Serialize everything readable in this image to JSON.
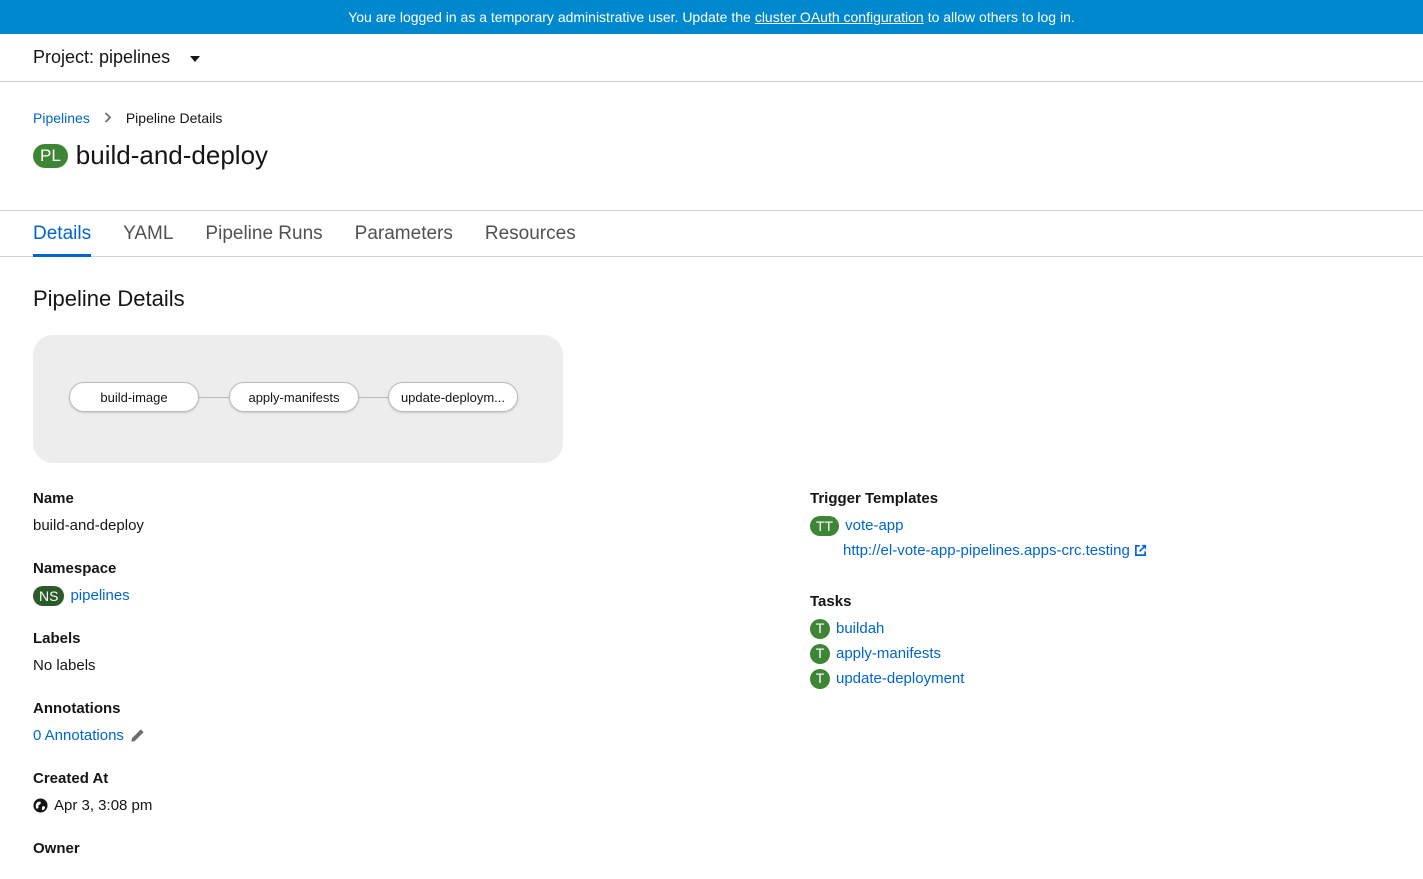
{
  "banner": {
    "text_before": "You are logged in as a temporary administrative user. Update the",
    "link": "cluster OAuth configuration",
    "text_after": "to allow others to log in."
  },
  "project": {
    "label": "Project: pipelines"
  },
  "breadcrumb": {
    "parent": "Pipelines",
    "current": "Pipeline Details"
  },
  "header": {
    "badge": "PL",
    "title": "build-and-deploy"
  },
  "tabs": [
    {
      "label": "Details",
      "active": true
    },
    {
      "label": "YAML"
    },
    {
      "label": "Pipeline Runs"
    },
    {
      "label": "Parameters"
    },
    {
      "label": "Resources"
    }
  ],
  "section_title": "Pipeline Details",
  "pipeline_nodes": [
    "build-image",
    "apply-manifests",
    "update-deploym..."
  ],
  "details": {
    "name": {
      "label": "Name",
      "value": "build-and-deploy"
    },
    "namespace": {
      "label": "Namespace",
      "badge": "NS",
      "value": "pipelines"
    },
    "labels": {
      "label": "Labels",
      "value": "No labels"
    },
    "annotations": {
      "label": "Annotations",
      "value": "0 Annotations"
    },
    "created_at": {
      "label": "Created At",
      "value": "Apr 3, 3:08 pm"
    },
    "owner": {
      "label": "Owner"
    }
  },
  "trigger_templates": {
    "label": "Trigger Templates",
    "badge": "TT",
    "name": "vote-app",
    "url": "http://el-vote-app-pipelines.apps-crc.testing"
  },
  "tasks": {
    "label": "Tasks",
    "badge": "T",
    "items": [
      "buildah",
      "apply-manifests",
      "update-deployment"
    ]
  },
  "colors": {
    "banner": "#0088ce",
    "link": "#0066cc",
    "badge_green": "#3e8635",
    "badge_ns": "#2b5a28"
  }
}
